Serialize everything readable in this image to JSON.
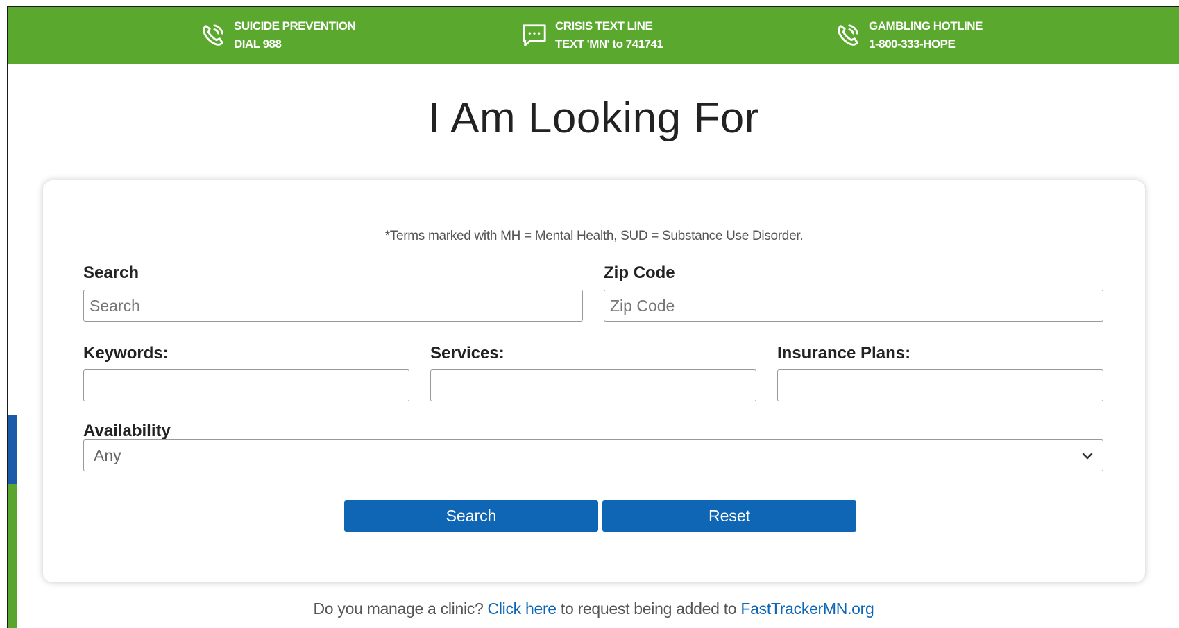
{
  "topbar": {
    "hotlines": [
      {
        "icon": "phone-icon",
        "line1": "SUICIDE PREVENTION",
        "line2": "DIAL 988"
      },
      {
        "icon": "chat-icon",
        "line1": "CRISIS TEXT LINE",
        "line2": "TEXT 'MN' to 741741"
      },
      {
        "icon": "phone-icon",
        "line1": "GAMBLING HOTLINE",
        "line2": "1-800-333-HOPE"
      }
    ],
    "color": "#5aa92e"
  },
  "page": {
    "title": "I Am Looking For"
  },
  "form": {
    "note": "*Terms marked with MH = Mental Health, SUD = Substance Use Disorder.",
    "search": {
      "label": "Search",
      "placeholder": "Search",
      "value": ""
    },
    "zip": {
      "label": "Zip Code",
      "placeholder": "Zip Code",
      "value": ""
    },
    "keywords": {
      "label": "Keywords:",
      "value": ""
    },
    "services": {
      "label": "Services:",
      "value": ""
    },
    "insurance": {
      "label": "Insurance Plans:",
      "value": ""
    },
    "availability": {
      "label": "Availability",
      "selected": "Any"
    },
    "search_button": "Search",
    "reset_button": "Reset",
    "button_color": "#0e66b4"
  },
  "footer": {
    "prefix": "Do you manage a clinic?",
    "link1": "Click here",
    "middle": "to request being added to",
    "link2": "FastTrackerMN.org"
  }
}
